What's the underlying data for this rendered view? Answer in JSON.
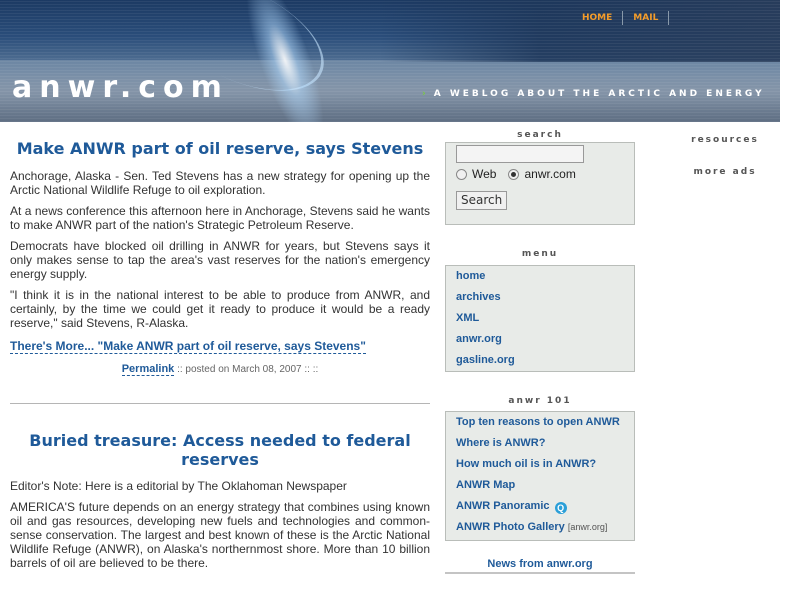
{
  "header": {
    "site_title": "anwr.com",
    "tagline": "A WEBLOG ABOUT THE ARCTIC AND ENERGY",
    "tagline_arrow": "›",
    "nav": [
      {
        "label": "HOME"
      },
      {
        "label": "MAIL"
      }
    ]
  },
  "posts": [
    {
      "title": "Make ANWR part of oil reserve, says Stevens",
      "paragraphs": [
        "Anchorage, Alaska - Sen. Ted Stevens has a new strategy for opening up the Arctic National Wildlife Refuge to oil exploration.",
        "At a news conference this afternoon here in Anchorage, Stevens said he wants to make ANWR part of the nation's Strategic Petroleum Reserve.",
        "Democrats have blocked oil drilling in ANWR for years, but Stevens says it only makes sense to tap the area's vast reserves for the nation's emergency energy supply.",
        "\"I think it is in the national interest to be able to produce from ANWR, and certainly, by the time we could get it ready to produce it would be a ready reserve,\" said Stevens, R-Alaska."
      ],
      "more_link": "There's More... \"Make ANWR part of oil reserve, says Stevens\"",
      "permalink": "Permalink",
      "posted_on": " :: posted on March 08, 2007 :: ::"
    },
    {
      "title": "Buried treasure: Access needed to federal reserves",
      "paragraphs": [
        "Editor's Note: Here is a editorial by The Oklahoman Newspaper",
        "AMERICA'S future depends on an energy strategy that combines using known oil and gas resources, developing new fuels and technologies and common-sense conservation. The largest and best known of these is the Arctic National Wildlife Refuge (ANWR), on Alaska's northernmost shore. More than 10 billion barrels of oil are believed to be there."
      ]
    }
  ],
  "sidebar": {
    "search": {
      "heading": "search",
      "input_value": "",
      "options": [
        {
          "label": "Web",
          "checked": false
        },
        {
          "label": "anwr.com",
          "checked": true
        }
      ],
      "button_label": "Search"
    },
    "menu": {
      "heading": "menu",
      "items": [
        {
          "label": "home"
        },
        {
          "label": "archives"
        },
        {
          "label": "XML"
        },
        {
          "label": "anwr.org"
        },
        {
          "label": "gasline.org"
        }
      ]
    },
    "anwr101": {
      "heading": "anwr 101",
      "items": [
        {
          "label": "Top ten reasons to open ANWR"
        },
        {
          "label": "Where is ANWR?"
        },
        {
          "label": "How much oil is in ANWR?"
        },
        {
          "label": "ANWR Map"
        },
        {
          "label": "ANWR Panoramic",
          "icon": "quicktime-icon",
          "icon_glyph": "Q"
        },
        {
          "label": "ANWR Photo Gallery",
          "suffix": "[anwr.org]"
        }
      ]
    },
    "news_link": "News from anwr.org"
  },
  "right": {
    "resources_heading": "resources",
    "more_ads_heading": "more ads"
  },
  "colors": {
    "link": "#1f5a99",
    "nav_orange": "#f39c2a",
    "box_bg": "#e8ebe8"
  }
}
